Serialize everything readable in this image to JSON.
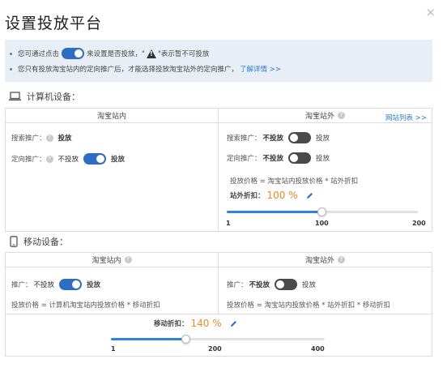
{
  "dialog": {
    "title": "设置投放平台",
    "close": "×"
  },
  "notice": {
    "line1_before": "您可通过点击",
    "line1_mid": "来设置是否投放，\"",
    "line1_after": "\"表示暂不可投放",
    "line2_text": "您只有投放淘宝站内的定向推广后，才能选择投放淘宝站外的定向推广，",
    "line2_link": "了解详情 >>"
  },
  "computer": {
    "section_title": "计算机设备：",
    "left_col_title": "淘宝站内",
    "right_col_title": "淘宝站外",
    "site_list_link": "网站列表 >>",
    "left": {
      "search_label": "搜索推广：",
      "search_state": "投放",
      "target_label": "定向推广：",
      "target_off": "不投放",
      "target_on": "投放"
    },
    "right": {
      "search_label": "搜索推广：",
      "search_off": "不投放",
      "search_on": "投放",
      "target_label": "定向推广：",
      "target_off": "不投放",
      "target_on": "投放",
      "price_note": "投放价格 = 淘宝站内投放价格 * 站外折扣",
      "discount_label": "站外折扣：",
      "discount_value": "100 %",
      "slider_value": 100,
      "slider_min": 1,
      "slider_max": 200,
      "ticks": [
        "1",
        "100",
        "200"
      ]
    }
  },
  "mobile": {
    "section_title": "移动设备：",
    "left_col_title": "淘宝站内",
    "right_col_title": "淘宝站外",
    "left": {
      "label": "推广：",
      "off": "不投放",
      "on": "投放",
      "price_note": "投放价格 = 计算机淘宝站内投放价格 * 移动折扣"
    },
    "right": {
      "label": "推广：",
      "off": "不投放",
      "on": "投放",
      "price_note": "投放价格 = 淘宝站内投放价格 * 站外折扣 * 移动折扣"
    },
    "discount_label": "移动折扣：",
    "discount_value": "140 %",
    "slider_value": 140,
    "slider_min": 1,
    "slider_max": 400,
    "ticks": [
      "1",
      "200",
      "400"
    ]
  },
  "colors": {
    "accent": "#2d6dc4",
    "orange": "#f08a1c",
    "notice_bg": "#e8eef5"
  }
}
